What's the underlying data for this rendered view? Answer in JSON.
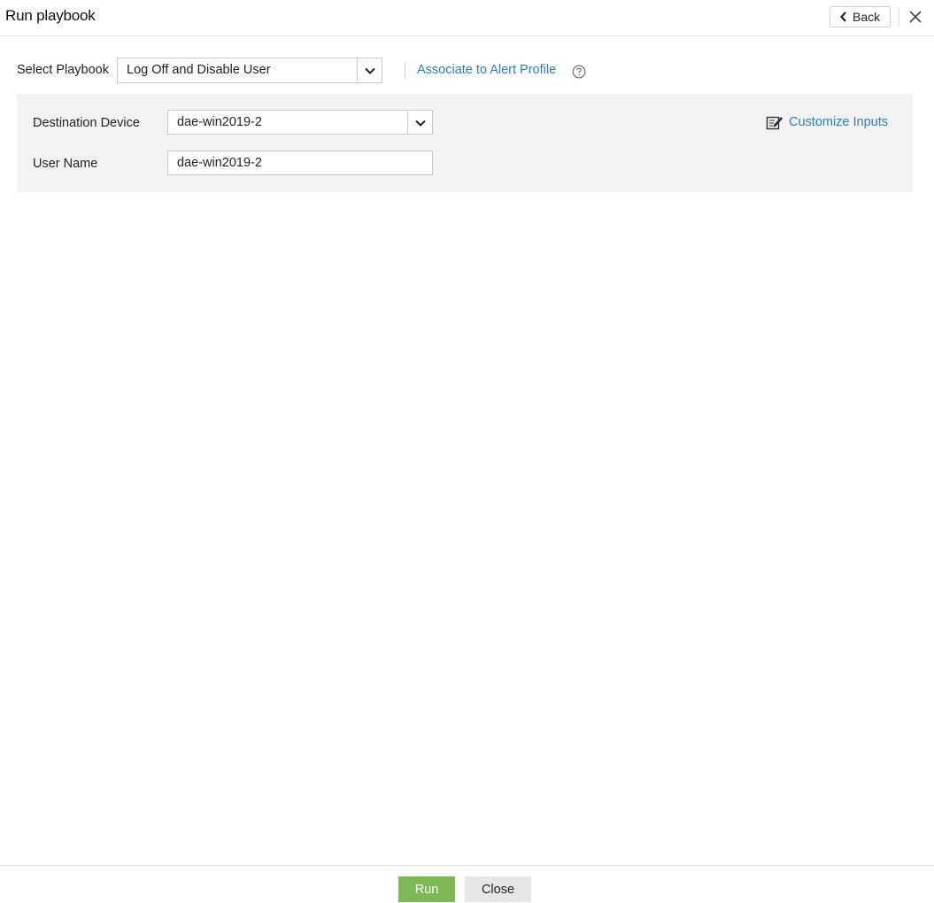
{
  "header": {
    "title": "Run playbook",
    "back_label": "Back"
  },
  "playbook": {
    "label": "Select Playbook",
    "selected": "Log Off and Disable User",
    "associate_link": "Associate to Alert Profile"
  },
  "inputs": {
    "destination_device_label": "Destination Device",
    "destination_device_value": "dae-win2019-2",
    "user_name_label": "User Name",
    "user_name_value": "dae-win2019-2",
    "customize_label": "Customize Inputs"
  },
  "footer": {
    "run_label": "Run",
    "close_label": "Close"
  },
  "colors": {
    "link": "#2a7fb8",
    "run_button": "#7cb954",
    "panel_bg": "#f3f3f3"
  },
  "icons": [
    "chevron-left-icon",
    "close-icon",
    "chevron-down-icon",
    "help-icon",
    "edit-icon"
  ]
}
